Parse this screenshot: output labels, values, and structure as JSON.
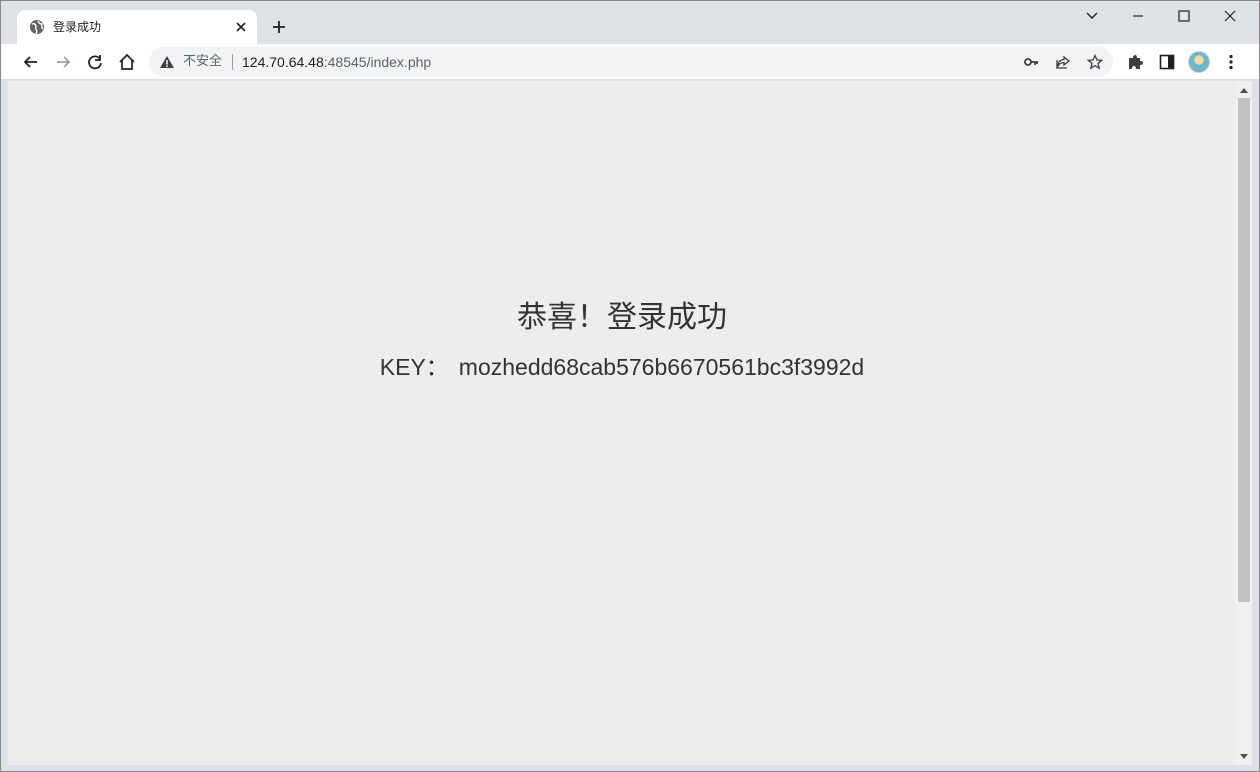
{
  "tab": {
    "title": "登录成功",
    "favicon": "globe-icon",
    "close": "close-icon"
  },
  "toolbar": {
    "security_label": "不安全",
    "url_host": "124.70.64.48",
    "url_rest": ":48545/index.php"
  },
  "page": {
    "headline": "恭喜！登录成功",
    "key_label": "KEY：",
    "key_value": "mozhedd68cab576b6670561bc3f3992d"
  },
  "colors": {
    "content_bg": "#ededed",
    "text": "#333333",
    "chrome_bg": "#dee1e6"
  }
}
